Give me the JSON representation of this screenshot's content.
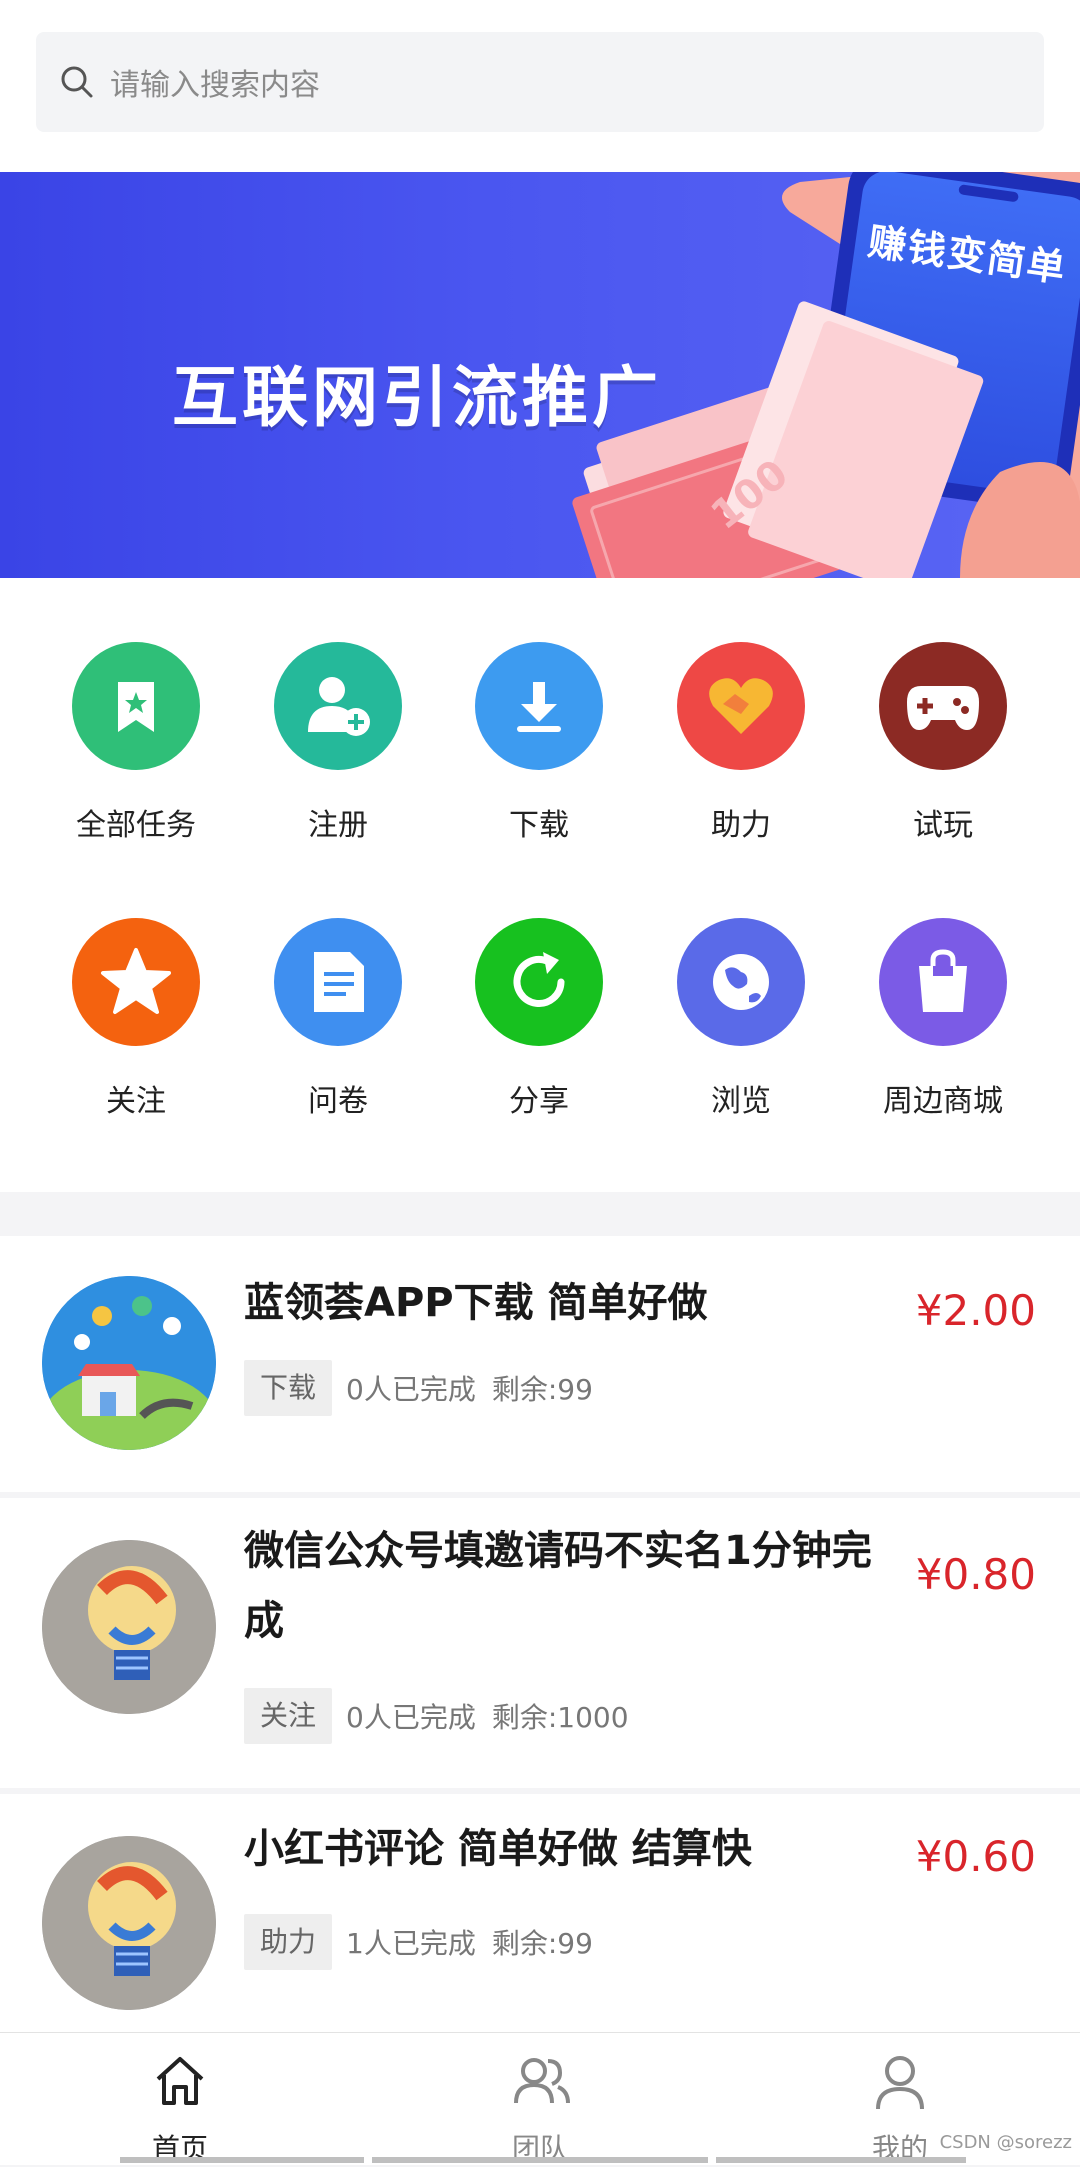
{
  "search": {
    "placeholder": "请输入搜索内容"
  },
  "banner": {
    "title": "互联网引流推广",
    "phone_text": "赚钱变简单",
    "bill_value": "100"
  },
  "categories": [
    {
      "label": "全部任务",
      "icon": "bookmark-star-icon",
      "color": "#2fbf78"
    },
    {
      "label": "注册",
      "icon": "user-add-icon",
      "color": "#25b99a"
    },
    {
      "label": "下载",
      "icon": "download-icon",
      "color": "#3d9bf0"
    },
    {
      "label": "助力",
      "icon": "handshake-heart-icon",
      "color": "#ee4845"
    },
    {
      "label": "试玩",
      "icon": "gamepad-icon",
      "color": "#8c2a24"
    },
    {
      "label": "关注",
      "icon": "star-icon",
      "color": "#f4620f"
    },
    {
      "label": "问卷",
      "icon": "document-icon",
      "color": "#3f8ff0"
    },
    {
      "label": "分享",
      "icon": "share-refresh-icon",
      "color": "#17c11f"
    },
    {
      "label": "浏览",
      "icon": "globe-icon",
      "color": "#5a6ae8"
    },
    {
      "label": "周边商城",
      "icon": "shopping-bag-icon",
      "color": "#7b5be6"
    }
  ],
  "tasks": [
    {
      "title": "蓝领荟APP下载 简单好做",
      "price": "¥2.00",
      "tag": "下载",
      "completed": "0人已完成",
      "remaining": "剩余:99",
      "avatar": "app-illustration-avatar"
    },
    {
      "title": "微信公众号填邀请码不实名1分钟完成",
      "price": "¥0.80",
      "tag": "关注",
      "completed": "0人已完成",
      "remaining": "剩余:1000",
      "avatar": "lightbulb-avatar"
    },
    {
      "title": "小红书评论 简单好做 结算快",
      "price": "¥0.60",
      "tag": "助力",
      "completed": "1人已完成",
      "remaining": "剩余:99",
      "avatar": "lightbulb-avatar"
    }
  ],
  "tabbar": {
    "items": [
      {
        "label": "首页",
        "icon": "home-icon",
        "active": true
      },
      {
        "label": "团队",
        "icon": "team-icon",
        "active": false
      },
      {
        "label": "我的",
        "icon": "profile-icon",
        "active": false
      }
    ]
  },
  "watermark": "CSDN @sorezz",
  "colors": {
    "price": "#d9252b",
    "banner": "#4a56f0"
  }
}
